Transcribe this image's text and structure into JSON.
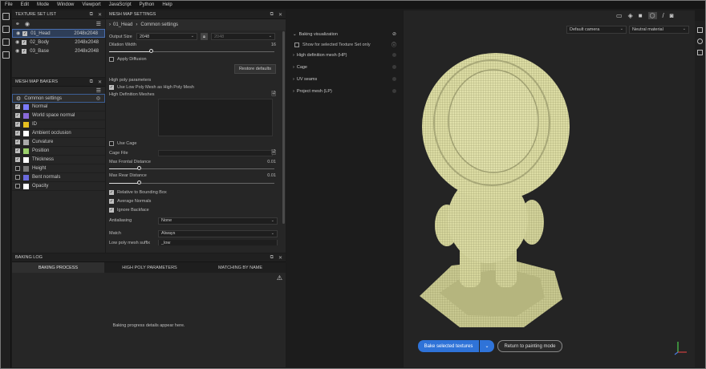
{
  "menu": [
    "File",
    "Edit",
    "Mode",
    "Window",
    "Viewport",
    "JavaScript",
    "Python",
    "Help"
  ],
  "texture_set_list": {
    "title": "TEXTURE SET LIST",
    "items": [
      {
        "name": "01_Head",
        "size": "2048x2048"
      },
      {
        "name": "02_Body",
        "size": "2048x2048"
      },
      {
        "name": "03_Base",
        "size": "2048x2048"
      }
    ]
  },
  "mesh_map_bakers": {
    "title": "MESH MAP BAKERS",
    "common": "Common settings",
    "items": [
      {
        "label": "Normal",
        "checked": true,
        "color": "#7b7bff"
      },
      {
        "label": "World space normal",
        "checked": true,
        "color": "#8a6ad8"
      },
      {
        "label": "ID",
        "checked": true,
        "color": "#e6c020"
      },
      {
        "label": "Ambient occlusion",
        "checked": true,
        "color": "#ffffff"
      },
      {
        "label": "Curvature",
        "checked": true,
        "color": "#aaaaaa"
      },
      {
        "label": "Position",
        "checked": true,
        "color": "#9bd06b"
      },
      {
        "label": "Thickness",
        "checked": true,
        "color": "#ffffff"
      },
      {
        "label": "Height",
        "checked": false,
        "color": "#777777"
      },
      {
        "label": "Bent normals",
        "checked": false,
        "color": "#6a6adc"
      },
      {
        "label": "Opacity",
        "checked": false,
        "color": "#ffffff"
      }
    ]
  },
  "mesh_map_settings": {
    "title": "MESH MAP SETTINGS",
    "breadcrumb_a": "01_Head",
    "breadcrumb_b": "Common settings",
    "output_size_label": "Output Size",
    "output_size": "2048",
    "output_size_locked": "2048",
    "dilation_label": "Dilation Width",
    "dilation_value": "16",
    "dilation_fraction": 0.25,
    "apply_diffusion": "Apply Diffusion",
    "restore_defaults": "Restore defaults",
    "high_poly_params": "High poly parameters",
    "use_low_poly": "Use Low Poly Mesh as High Poly Mesh",
    "high_def_meshes": "High Definition Meshes",
    "use_cage": "Use Cage",
    "cage_file": "Cage File",
    "max_frontal_label": "Max Frontal Distance",
    "max_frontal_value": "0.01",
    "max_frontal_fraction": 0.18,
    "max_rear_label": "Max Rear Distance",
    "max_rear_value": "0.01",
    "max_rear_fraction": 0.18,
    "relative_bbox": "Relative to Bounding Box",
    "average_normals": "Average Normals",
    "ignore_backface": "Ignore Backface",
    "antialiasing_label": "Antialiasing",
    "antialiasing_value": "None",
    "match_label": "Match",
    "match_value": "Always",
    "low_poly_suffix_label": "Low poly mesh suffix",
    "low_poly_suffix_value": "_low"
  },
  "baking_log": {
    "title": "BAKING LOG",
    "tabs": [
      "BAKING PROCESS",
      "HIGH POLY PARAMETERS",
      "MATCHING BY NAME"
    ],
    "placeholder": "Baking progress details appear here."
  },
  "baking_panel": {
    "visualization": "Baking visualization",
    "show_selected": "Show for selected Texture Set only",
    "sections": [
      "High definition mesh (HP)",
      "Cage",
      "UV seams",
      "Project mesh (LP)"
    ]
  },
  "viewport": {
    "camera": "Default camera",
    "material": "Neutral material",
    "bake_button": "Bake selected textures",
    "return_button": "Return to painting mode"
  },
  "colors": {
    "accent": "#2f73d8",
    "mesh": "#d9d9a0"
  }
}
